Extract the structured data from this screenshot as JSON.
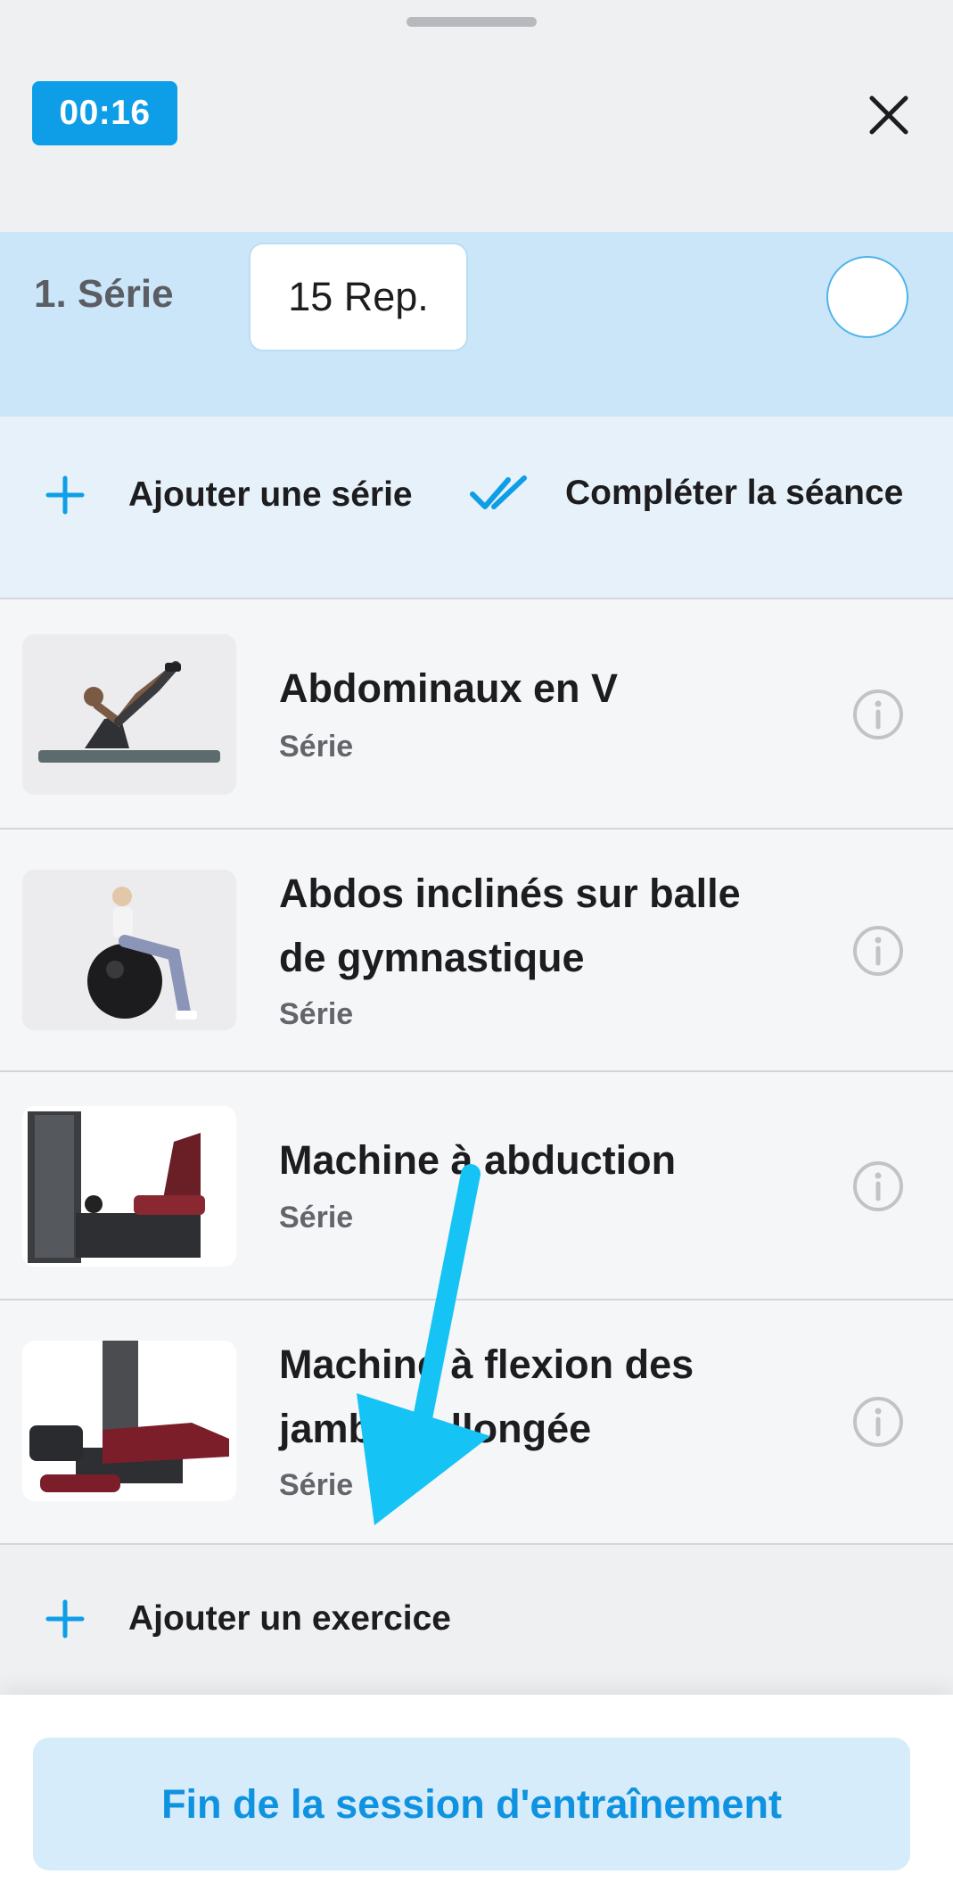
{
  "header": {
    "timer": "00:16",
    "close_icon": "close-icon"
  },
  "set": {
    "label": "1. Série",
    "reps_value": "15 Rep.",
    "check_icon": "circle-check-icon"
  },
  "actions": {
    "add_set_label": "Ajouter une série",
    "complete_label": "Compléter la séance",
    "accent_color": "#0e9ee8"
  },
  "exercises": [
    {
      "title": "Abdominaux en V",
      "subtitle": "Série"
    },
    {
      "title": "Abdos inclinés sur balle de gymnastique",
      "subtitle": "Série"
    },
    {
      "title": "Machine à abduction",
      "subtitle": "Série"
    },
    {
      "title": "Machine à flexion des jambes allongée",
      "subtitle": "Série"
    }
  ],
  "add_exercise_label": "Ajouter un exercice",
  "footer": {
    "end_label": "Fin de la session d'entraînement"
  }
}
